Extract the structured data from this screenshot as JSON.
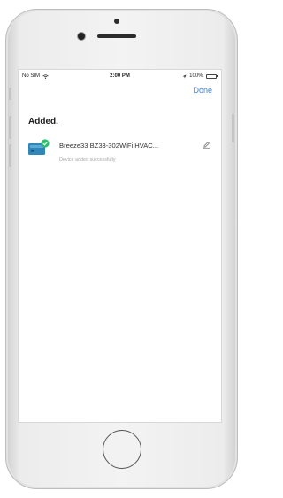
{
  "status_bar": {
    "carrier": "No SIM",
    "time": "2:00 PM",
    "battery": "100%",
    "icons": [
      "wifi-icon",
      "location-icon",
      "battery-icon"
    ]
  },
  "header": {
    "done_label": "Done"
  },
  "main": {
    "title": "Added.",
    "devices": [
      {
        "name": "Breeze33 BZ33-302WiFi HVAC...",
        "status": "Device added successfully",
        "icon": "hvac-device-icon"
      }
    ]
  },
  "colors": {
    "accent": "#3e82d8",
    "success_badge": "#2bbf6a",
    "device_icon": "#2f86b8",
    "battery": "#3fc94a"
  }
}
